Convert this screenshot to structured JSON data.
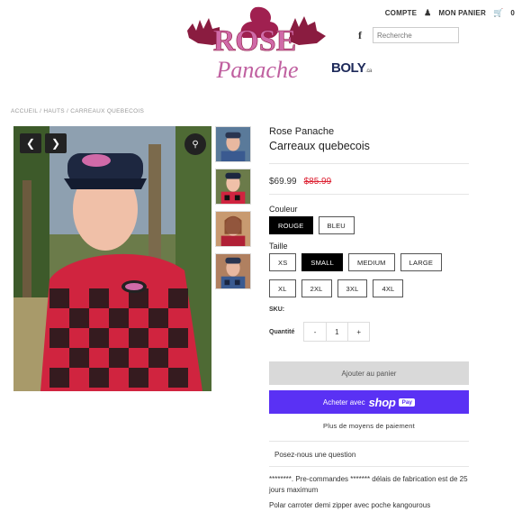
{
  "header": {
    "account_label": "COMPTE",
    "cart_label": "MON PANIER",
    "cart_count": "0",
    "facebook_glyph": "f",
    "search_placeholder": "Recherche"
  },
  "logo": {
    "line1": "ROSE",
    "line2": "Panache",
    "partner": "BOLY",
    "partner_suffix": ".ca"
  },
  "breadcrumb": "ACCUEIL / HAUTS / CARREAUX QUEBECOIS",
  "product": {
    "brand": "Rose Panache",
    "title": "Carreaux quebecois",
    "price_now": "$69.99",
    "price_old": "$85.99",
    "color_label": "Couleur",
    "colors": [
      "ROUGE",
      "BLEU"
    ],
    "color_selected": "ROUGE",
    "size_label": "Taille",
    "sizes_row1": [
      "XS",
      "SMALL",
      "MEDIUM",
      "LARGE"
    ],
    "sizes_row2": [
      "XL",
      "2XL",
      "3XL",
      "4XL"
    ],
    "size_selected": "SMALL",
    "sku_label": "SKU:",
    "qty_label": "Quantité",
    "qty_minus": "-",
    "qty_value": "1",
    "qty_plus": "+",
    "add_to_cart": "Ajouter au panier",
    "shop_pay_prefix": "Acheter avec",
    "shop_pay_word": "shop",
    "shop_pay_badge": "Pay",
    "more_payment": "Plus de moyens de paiement",
    "ask_question": "Posez-nous une question",
    "desc1": "********. Pre-commandes  ******* délais de fabrication est de 25 jours maximum",
    "desc2": "Polar carroter demi zipper  avec poche kangourous"
  },
  "colors": {
    "accent_pink": "#d06aa8",
    "shop_pay": "#5a31f4",
    "sale_red": "#dd2233"
  }
}
